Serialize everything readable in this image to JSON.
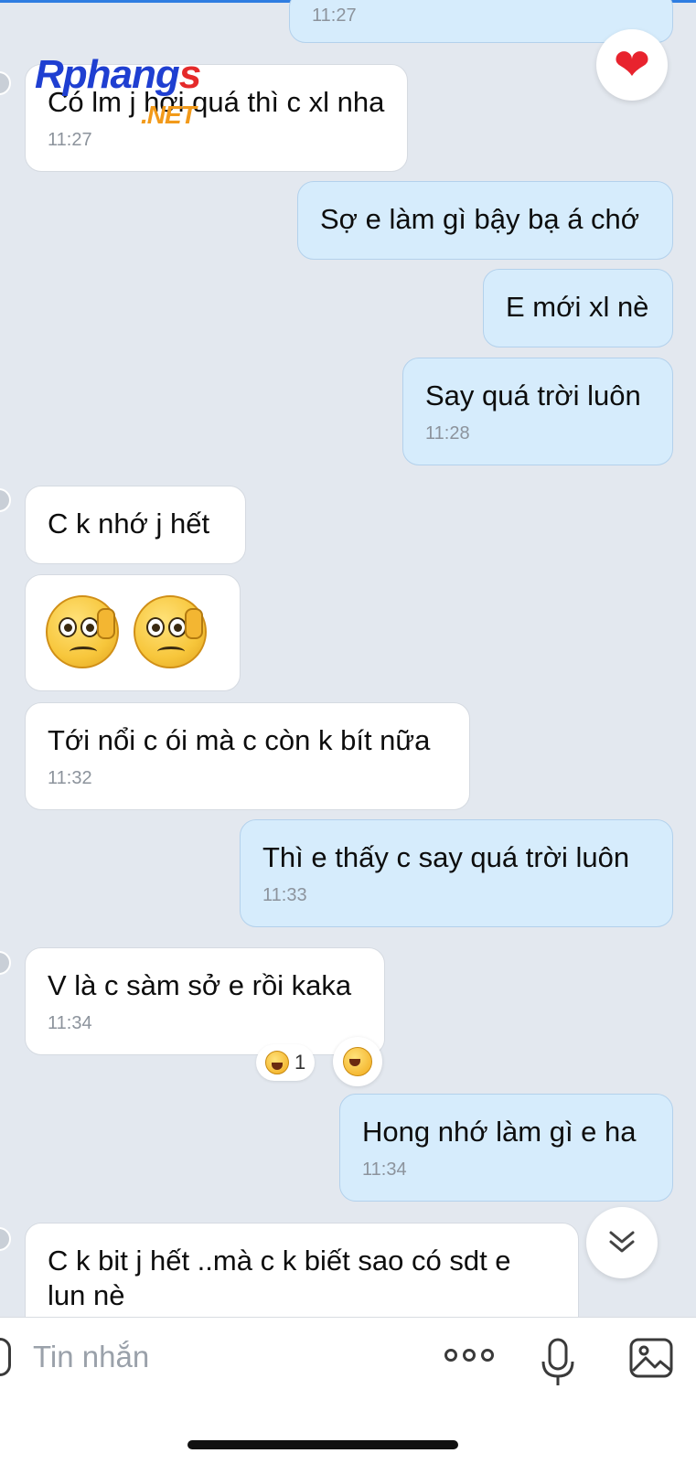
{
  "watermark": {
    "part1": "Rphang",
    "part2": "s",
    "part3": ".NET"
  },
  "messages": [
    {
      "dir": "out",
      "text": "",
      "time": "11:27"
    },
    {
      "dir": "in",
      "text": "Có lm j hơi quá thì c xl nha",
      "time": "11:27"
    },
    {
      "dir": "out",
      "text": "Sợ e làm gì bậy bạ á chớ",
      "time": ""
    },
    {
      "dir": "out",
      "text": "E mới xl nè",
      "time": ""
    },
    {
      "dir": "out",
      "text": "Say quá trời luôn",
      "time": "11:28"
    },
    {
      "dir": "in",
      "text": "C k nhớ j hết",
      "time": ""
    },
    {
      "dir": "in",
      "text": "",
      "time": "",
      "emojis": [
        "pleading-hand-face",
        "pleading-hand-face"
      ]
    },
    {
      "dir": "in",
      "text": "Tới nổi c ói mà c còn k bít nữa",
      "time": "11:32"
    },
    {
      "dir": "out",
      "text": "Thì e thấy c say quá trời luôn",
      "time": "11:33"
    },
    {
      "dir": "in",
      "text": "V là c sàm sở e rồi kaka",
      "time": "11:34"
    },
    {
      "dir": "out",
      "text": "Hong nhớ làm gì e ha",
      "time": "11:34"
    },
    {
      "dir": "in",
      "text": "C k bit j hết ..mà c k biết sao có sdt e lun nè",
      "time": ""
    }
  ],
  "reaction": {
    "icon": "laughing-emoji",
    "count": "1"
  },
  "input": {
    "placeholder": "Tin nhắn"
  },
  "icons": {
    "heart": "heart-icon",
    "scroll": "chevron-double-down-icon",
    "more": "more-options-icon",
    "mic": "microphone-icon",
    "image": "image-icon"
  },
  "colors": {
    "incoming": "#ffffff",
    "outgoing": "#d6ecfc",
    "background": "#e3e8ef",
    "heart": "#e8232e"
  }
}
